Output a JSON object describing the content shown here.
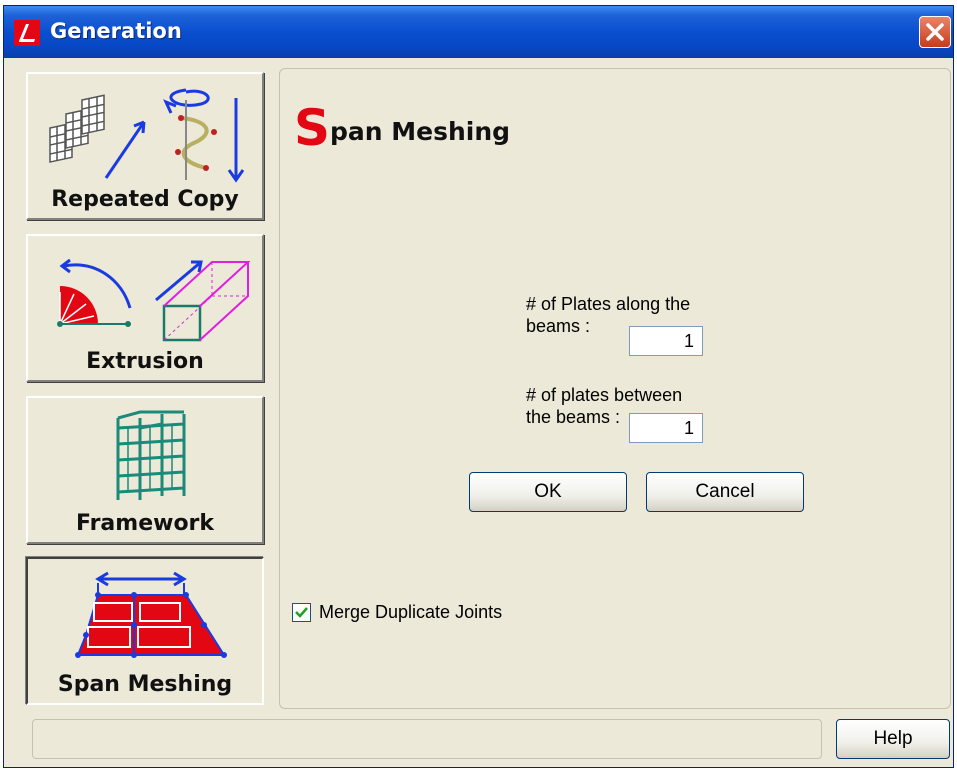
{
  "window": {
    "title": "Generation"
  },
  "sidebar": {
    "items": [
      {
        "label": "Repeated Copy",
        "icon": "repeated-copy-icon",
        "active": false
      },
      {
        "label": "Extrusion",
        "icon": "extrusion-icon",
        "active": false
      },
      {
        "label": "Framework",
        "icon": "framework-icon",
        "active": false
      },
      {
        "label": "Span Meshing",
        "icon": "span-meshing-icon",
        "active": true
      }
    ]
  },
  "panel": {
    "title_initial": "S",
    "title_rest": "pan Meshing",
    "fields": [
      {
        "label_line1": "# of Plates along the",
        "label_line2": "beams :",
        "value": "1"
      },
      {
        "label_line1": "# of plates between",
        "label_line2": "the beams :",
        "value": "1"
      }
    ],
    "ok_label": "OK",
    "cancel_label": "Cancel",
    "merge_label": "Merge Duplicate Joints",
    "merge_checked": true
  },
  "footer": {
    "help_label": "Help"
  },
  "colors": {
    "title_accent": "#e30613",
    "titlebar": "#0a4fd0",
    "mesh_red": "#e30613"
  }
}
